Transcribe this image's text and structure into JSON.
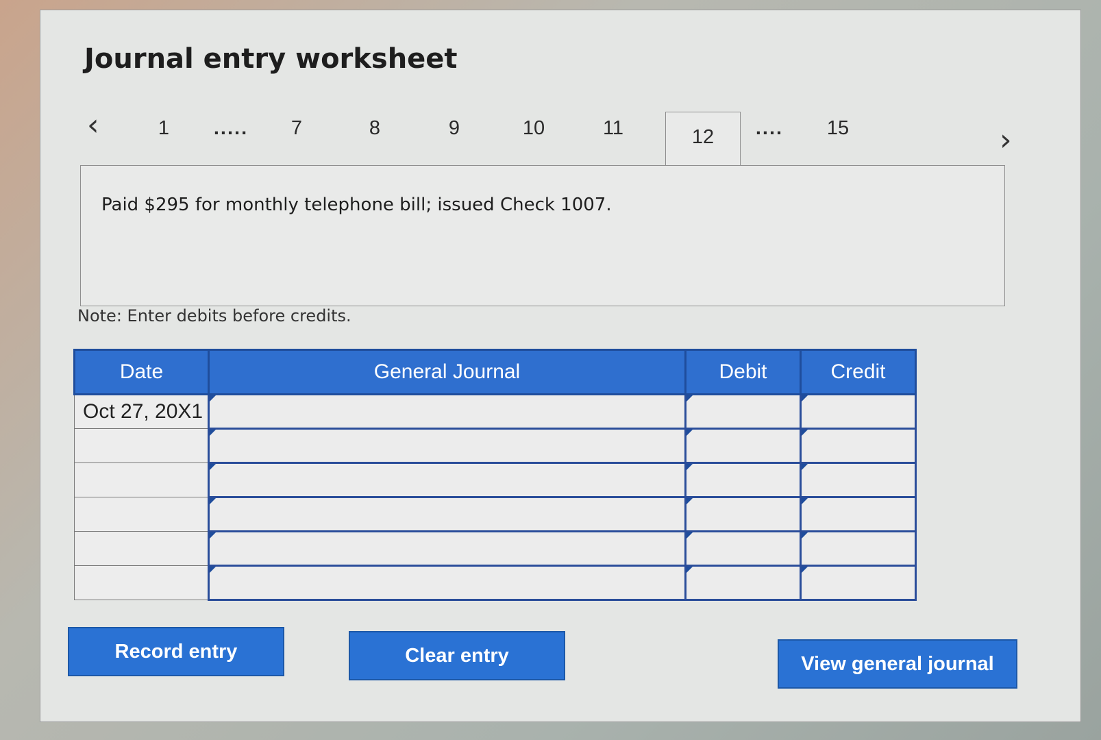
{
  "worksheet": {
    "title": "Journal entry worksheet",
    "tabs": [
      {
        "label": "1"
      },
      {
        "label": "....."
      },
      {
        "label": "7"
      },
      {
        "label": "8"
      },
      {
        "label": "9"
      },
      {
        "label": "10"
      },
      {
        "label": "11"
      },
      {
        "label": "12",
        "active": true
      },
      {
        "label": "...."
      },
      {
        "label": "15"
      }
    ],
    "prompt": "Paid $295 for monthly telephone bill; issued Check 1007.",
    "note": "Note: Enter debits before credits."
  },
  "journal_table": {
    "headers": {
      "date": "Date",
      "general_journal": "General Journal",
      "debit": "Debit",
      "credit": "Credit"
    },
    "rows": [
      {
        "date": "Oct 27, 20X1",
        "account": "",
        "debit": "",
        "credit": ""
      },
      {
        "date": "",
        "account": "",
        "debit": "",
        "credit": ""
      },
      {
        "date": "",
        "account": "",
        "debit": "",
        "credit": ""
      },
      {
        "date": "",
        "account": "",
        "debit": "",
        "credit": ""
      },
      {
        "date": "",
        "account": "",
        "debit": "",
        "credit": ""
      },
      {
        "date": "",
        "account": "",
        "debit": "",
        "credit": ""
      }
    ]
  },
  "buttons": {
    "record": "Record entry",
    "clear": "Clear entry",
    "view": "View general journal"
  },
  "icons": {
    "prev": "chevron-left-icon",
    "next": "chevron-right-icon"
  },
  "colors": {
    "accent": "#2a72d4",
    "header_bg": "#2f6fcf",
    "border_blue": "#2a4d9a"
  }
}
